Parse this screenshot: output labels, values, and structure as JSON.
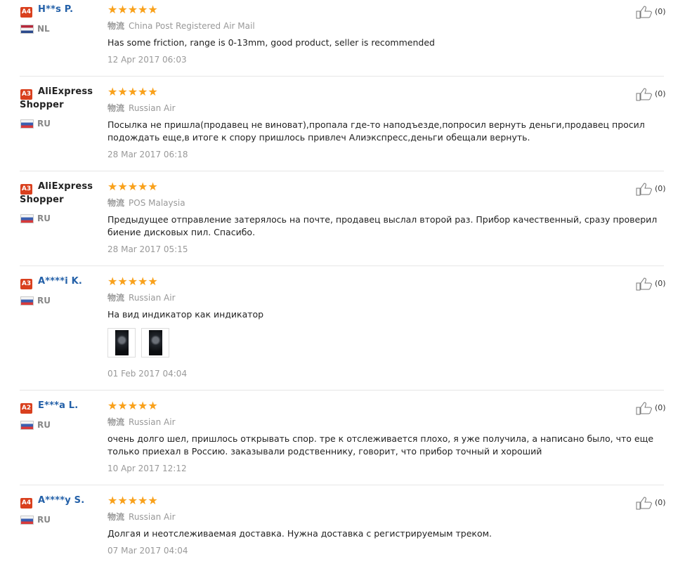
{
  "logistics_label": "物流",
  "reviews": [
    {
      "level": "A4",
      "name": "H**s P.",
      "name_line2": "",
      "country": "NL",
      "stars": "★★★★★",
      "shipping": "China Post Registered Air Mail",
      "text": "Has some friction, range is 0-13mm, good product, seller is recommended",
      "date": "12 Apr 2017 06:03",
      "likes": "(0)"
    },
    {
      "level": "A3",
      "name": "AliExpress",
      "name_line2": "Shopper",
      "country": "RU",
      "stars": "★★★★★",
      "shipping": "Russian Air",
      "text": "Посылка не пришла(продавец не виноват),пропала где-то наподъезде,попросил вернуть деньги,продавец просил подождать еще,в итоге к спору пришлось привлеч Алиэкспресс,деньги обещали вернуть.",
      "date": "28 Mar 2017 06:18",
      "likes": "(0)"
    },
    {
      "level": "A3",
      "name": "AliExpress",
      "name_line2": "Shopper",
      "country": "RU",
      "stars": "★★★★★",
      "shipping": "POS Malaysia",
      "text": "Предыдущее отправление затерялось на почте, продавец выслал второй раз. Прибор качественный, сразу проверил биение дисковых пил. Спасибо.",
      "date": "28 Mar 2017 05:15",
      "likes": "(0)"
    },
    {
      "level": "A3",
      "name": "A****i K.",
      "name_line2": "",
      "country": "RU",
      "stars": "★★★★★",
      "shipping": "Russian Air",
      "text": "На вид индикатор как индикатор",
      "date": "01 Feb 2017 04:04",
      "likes": "(0)"
    },
    {
      "level": "A2",
      "name": "E***a L.",
      "name_line2": "",
      "country": "RU",
      "stars": "★★★★★",
      "shipping": "Russian Air",
      "text": "очень долго шел, пришлось открывать спор. тре к отслеживается плохо, я уже получила, а написано было, что еще только приехал в Россию. заказывали родственнику, говорит, что прибор точный и хороший",
      "date": "10 Apr 2017 12:12",
      "likes": "(0)"
    },
    {
      "level": "A4",
      "name": "A****y S.",
      "name_line2": "",
      "country": "RU",
      "stars": "★★★★★",
      "shipping": "Russian Air",
      "text": "Долгая и неотслеживаемая доставка. Нужна доставка с регистрируемым треком.",
      "date": "07 Mar 2017 04:04",
      "likes": "(0)"
    }
  ]
}
